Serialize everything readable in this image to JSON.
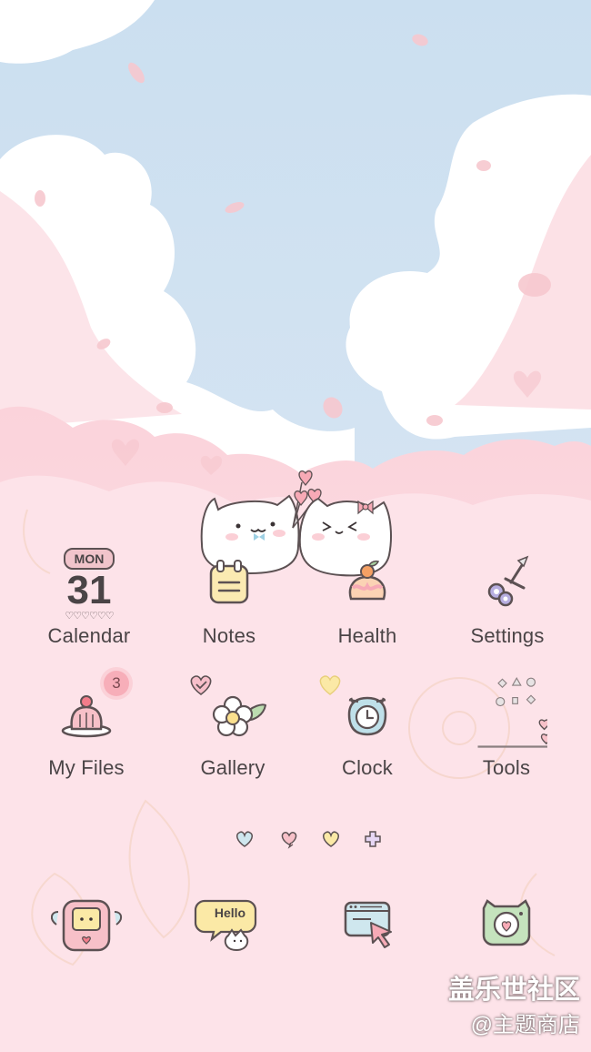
{
  "home": {
    "calendar_widget": {
      "day": "MON",
      "date": "31"
    },
    "apps": [
      {
        "label": "Calendar",
        "icon": "calendar-icon"
      },
      {
        "label": "Notes",
        "icon": "notes-icon"
      },
      {
        "label": "Health",
        "icon": "health-icon"
      },
      {
        "label": "Settings",
        "icon": "scissors-settings-icon"
      },
      {
        "label": "My Files",
        "icon": "jelly-pudding-files-icon",
        "badge": "3"
      },
      {
        "label": "Gallery",
        "icon": "flower-gallery-icon"
      },
      {
        "label": "Clock",
        "icon": "cat-clock-icon"
      },
      {
        "label": "Tools",
        "icon": "tools-folder-icon"
      }
    ],
    "page_indicators": [
      "heart-indicator-icon",
      "chat-heart-indicator-icon",
      "yellow-heart-indicator-icon",
      "plus-indicator-icon"
    ],
    "dock": [
      {
        "icon": "phone-icon"
      },
      {
        "icon": "hello-messages-icon",
        "text": "Hello"
      },
      {
        "icon": "browser-icon"
      },
      {
        "icon": "cat-camera-icon"
      }
    ]
  },
  "watermark": {
    "line1": "盖乐世社区",
    "line2": "@主题商店"
  },
  "colors": {
    "sky": "#cfe1f0",
    "cloud": "#ffffff",
    "ground": "#fde5ea",
    "text": "#4a4446",
    "badge": "#f7aeb9"
  }
}
